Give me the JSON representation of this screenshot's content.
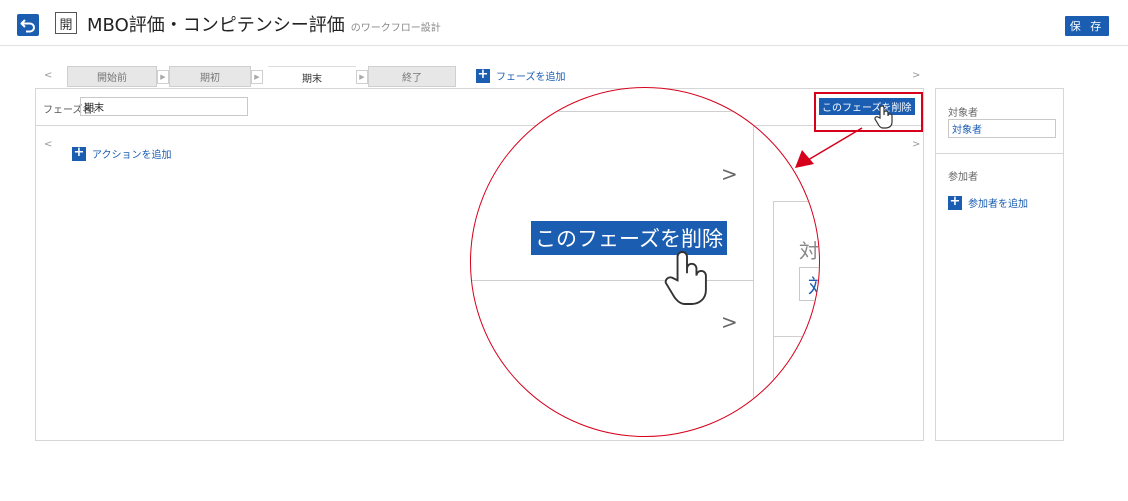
{
  "header": {
    "back_icon": "undo-arrow-icon",
    "status_char": "開",
    "title": "MBO評価・コンピテンシー評価",
    "subtitle": "のワークフロー設計",
    "save_label": "保 存"
  },
  "phases": {
    "prev_arrow": "<",
    "next_arrow": ">",
    "tabs": [
      {
        "label": "開始前",
        "active": false
      },
      {
        "label": "期初",
        "active": false
      },
      {
        "label": "期末",
        "active": true
      },
      {
        "label": "終了",
        "active": false
      }
    ],
    "add_phase_label": "フェーズを追加"
  },
  "phase_editor": {
    "name_label": "フェーズ名:",
    "name_value": "期末",
    "delete_label": "このフェーズを削除",
    "actions_prev": "<",
    "actions_next": ">",
    "add_action_label": "アクションを追加"
  },
  "sidebar": {
    "target_label": "対象者",
    "target_value": "対象者",
    "participants_label": "参加者",
    "add_participant_label": "参加者を追加"
  },
  "magnifier": {
    "arrow_top": ">",
    "arrow_bottom": ">",
    "partial_char_1": "対",
    "partial_char_2": "対"
  },
  "colors": {
    "accent": "#1a5db1",
    "highlight": "#d6001c"
  }
}
